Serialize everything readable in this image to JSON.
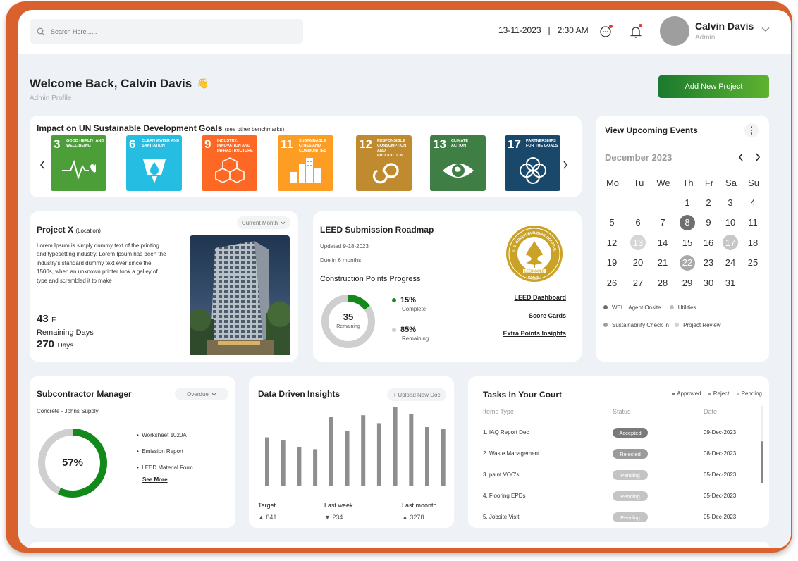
{
  "header": {
    "search_placeholder": "Search Here......",
    "datetime": "13-11-2023   |   2:30 AM",
    "user_name": "Calvin Davis",
    "user_role": "Admin"
  },
  "welcome": {
    "title": "Welcome Back, Calvin Davis",
    "subtitle": "Admin Profile",
    "add_button": "Add New Project"
  },
  "sdg_panel": {
    "title": "Impact on UN Sustainable Development Goals",
    "title_note": "(see other benchmarks)",
    "goals": [
      {
        "num": "3",
        "label": "GOOD HEALTH AND WELL-BEING",
        "color": "#4c9f38",
        "icon": "heartbeat-icon"
      },
      {
        "num": "6",
        "label": "CLEAN WATER AND SANITATION",
        "color": "#26bde2",
        "icon": "water-drop-icon"
      },
      {
        "num": "9",
        "label": "INDUSTRY, INNOVATION AND INFRASTRUCTURE",
        "color": "#fd6925",
        "icon": "cubes-icon"
      },
      {
        "num": "11",
        "label": "SUSTAINABLE CITIES AND COMMUNITIES",
        "color": "#fd9d24",
        "icon": "city-icon"
      },
      {
        "num": "12",
        "label": "RESPONSIBLE CONSUMPTION AND PRODUCTION",
        "color": "#bf8b2e",
        "icon": "infinity-icon"
      },
      {
        "num": "13",
        "label": "CLIMATE ACTION",
        "color": "#3f7e44",
        "icon": "eye-globe-icon"
      },
      {
        "num": "17",
        "label": "PARTNERSHIPS FOR THE GOALS",
        "color": "#19486a",
        "icon": "rings-icon"
      }
    ]
  },
  "project": {
    "title": "Project X",
    "title_note": "(Location)",
    "period": "Current Month",
    "description": "Lorem Ipsum is simply dummy text of the printing and typesetting industry. Lorem Ipsum has been the industry's standard dummy text ever since the 1500s, when an unknown printer took a galley of type and scrambled it to make",
    "floors_value": "43",
    "floors_unit": "F",
    "remaining_label": "Remaining Days",
    "days_value": "270",
    "days_unit": "Days"
  },
  "leed": {
    "title": "LEED Submission Roadmap",
    "updated": "Updated 9-18-2023",
    "due": "Due in 6 months",
    "progress_title": "Construction Points Progress",
    "donut_value": "35",
    "donut_label": "Remaining",
    "complete_fraction": 0.15,
    "complete_pct": "15%",
    "complete_label": "Complete",
    "remaining_pct": "85%",
    "remaining_label": "Remaining",
    "links": [
      "LEED Dashboard",
      "Score Cards",
      "Extra Points Insights"
    ],
    "badge_text_top": "U.S. GREEN BUILDING COUNCIL",
    "badge_text_mid": "LEED GOLD",
    "badge_text_bottom": "USGBC"
  },
  "events": {
    "title": "View Upcoming Events",
    "month": "December 2023",
    "weekdays": [
      "Mo",
      "Tu",
      "We",
      "Th",
      "Fr",
      "Sa",
      "Su"
    ],
    "weeks": [
      [
        "",
        "",
        "",
        "1",
        "2",
        "3",
        "4"
      ],
      [
        "5",
        "6",
        "7",
        "8",
        "9",
        "10",
        "11"
      ],
      [
        "12",
        "13",
        "14",
        "15",
        "16",
        "17",
        "18"
      ],
      [
        "19",
        "20",
        "21",
        "22",
        "23",
        "24",
        "25"
      ],
      [
        "26",
        "27",
        "28",
        "29",
        "30",
        "31",
        ""
      ]
    ],
    "legend": [
      {
        "label": "WELL Agent Onsite",
        "color": "#6b6b6b"
      },
      {
        "label": "Utilities",
        "color": "#bdbdbd"
      },
      {
        "label": "Sustainability Check In",
        "color": "#9e9e9e"
      },
      {
        "label": "Project Review",
        "color": "#d0d0d0"
      }
    ]
  },
  "subcontractor": {
    "title": "Subcontractor Manager",
    "filter": "Overdue",
    "subtitle": "Concrete - Johns Supply",
    "percent": "57%",
    "fraction": 0.57,
    "items": [
      "Worksheet 1020A",
      "Emission Report",
      "LEED Material Form"
    ],
    "see_more": "See More"
  },
  "insights": {
    "title": "Data Driven Insights",
    "upload": "+ Upload New Doc",
    "labels": [
      {
        "label": "Target",
        "value": "841",
        "trend": "up"
      },
      {
        "label": "Last week",
        "value": "234",
        "trend": "down"
      },
      {
        "label": "Last moonth",
        "value": "3278",
        "trend": "up"
      }
    ]
  },
  "chart_data": {
    "type": "bar",
    "values": [
      62,
      58,
      50,
      47,
      88,
      70,
      90,
      80,
      100,
      92,
      75,
      73
    ],
    "title": "",
    "xlabel": "",
    "ylabel": "",
    "grid": false
  },
  "tasks": {
    "title": "Tasks In Your Court",
    "legend": [
      {
        "label": "Approved",
        "color": "#777"
      },
      {
        "label": "Reject",
        "color": "#999"
      },
      {
        "label": "Pending",
        "color": "#bbb"
      }
    ],
    "columns": [
      "Items Type",
      "Status",
      "Date"
    ],
    "rows": [
      {
        "item": "1.  IAQ Report Dec",
        "status": "Accepted",
        "status_color": "#7a7a7a",
        "date": "09-Dec-2023"
      },
      {
        "item": "2.  Waste Management",
        "status": "Rejected",
        "status_color": "#9b9b9b",
        "date": "08-Dec-2023"
      },
      {
        "item": "3.  paint VOC's",
        "status": "Pending",
        "status_color": "#c4c4c4",
        "date": "05-Dec-2023"
      },
      {
        "item": "4.  Flooring EPDs",
        "status": "Pending",
        "status_color": "#c4c4c4",
        "date": "05-Dec-2023"
      },
      {
        "item": "5.  Jobsite Visit",
        "status": "Pending",
        "status_color": "#c4c4c4",
        "date": "05-Dec-2023"
      }
    ]
  }
}
